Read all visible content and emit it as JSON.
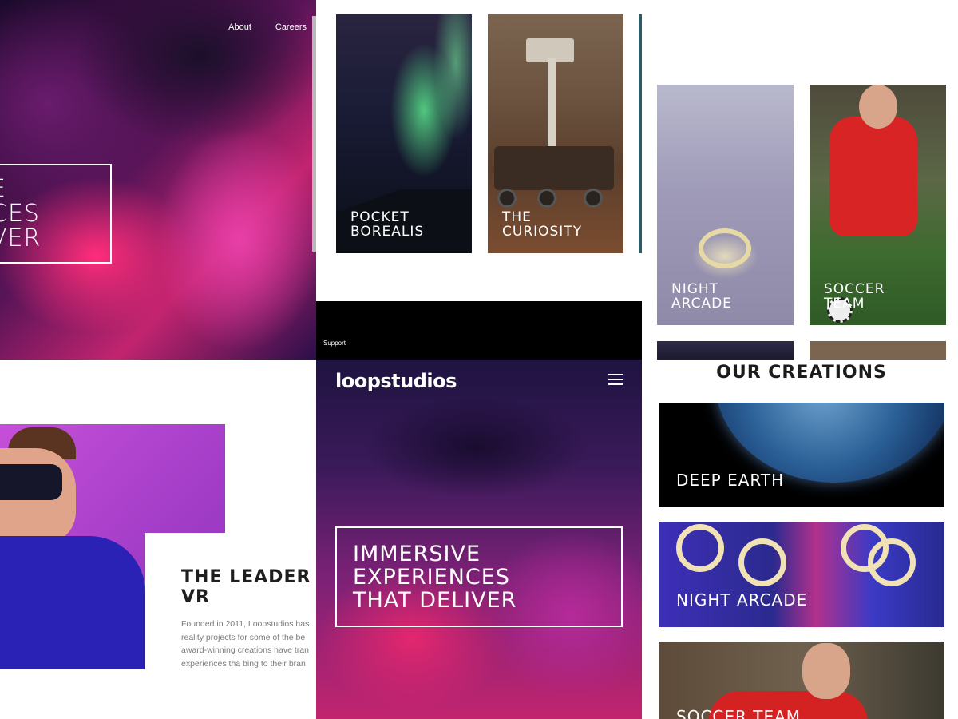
{
  "desktop": {
    "nav": [
      "About",
      "Careers"
    ],
    "hero_lines": [
      "E",
      "CES",
      "VER"
    ]
  },
  "grid_cards": [
    {
      "lines": [
        "POCKET",
        "BOREALIS"
      ]
    },
    {
      "lines": [
        "THE",
        "CURIOSITY"
      ]
    }
  ],
  "tablet_cards": [
    {
      "lines": [
        "NIGHT",
        "ARCADE"
      ]
    },
    {
      "lines": [
        "SOCCER",
        "TEAM"
      ]
    }
  ],
  "mobile": {
    "support_link": "Support",
    "logo": "loopstudios",
    "hero_lines": [
      "IMMERSIVE",
      "EXPERIENCES",
      "THAT DELIVER"
    ]
  },
  "about": {
    "title_lines": [
      "THE LEADER IN",
      "VR"
    ],
    "body_lines": [
      "Founded in 2011, Loopstudios has",
      "reality projects for some of the be",
      "award-winning creations have tran",
      "experiences tha bing to their bran"
    ]
  },
  "creations": {
    "heading": "OUR CREATIONS",
    "items": [
      "DEEP EARTH",
      "NIGHT ARCADE",
      "SOCCER TEAM"
    ]
  }
}
